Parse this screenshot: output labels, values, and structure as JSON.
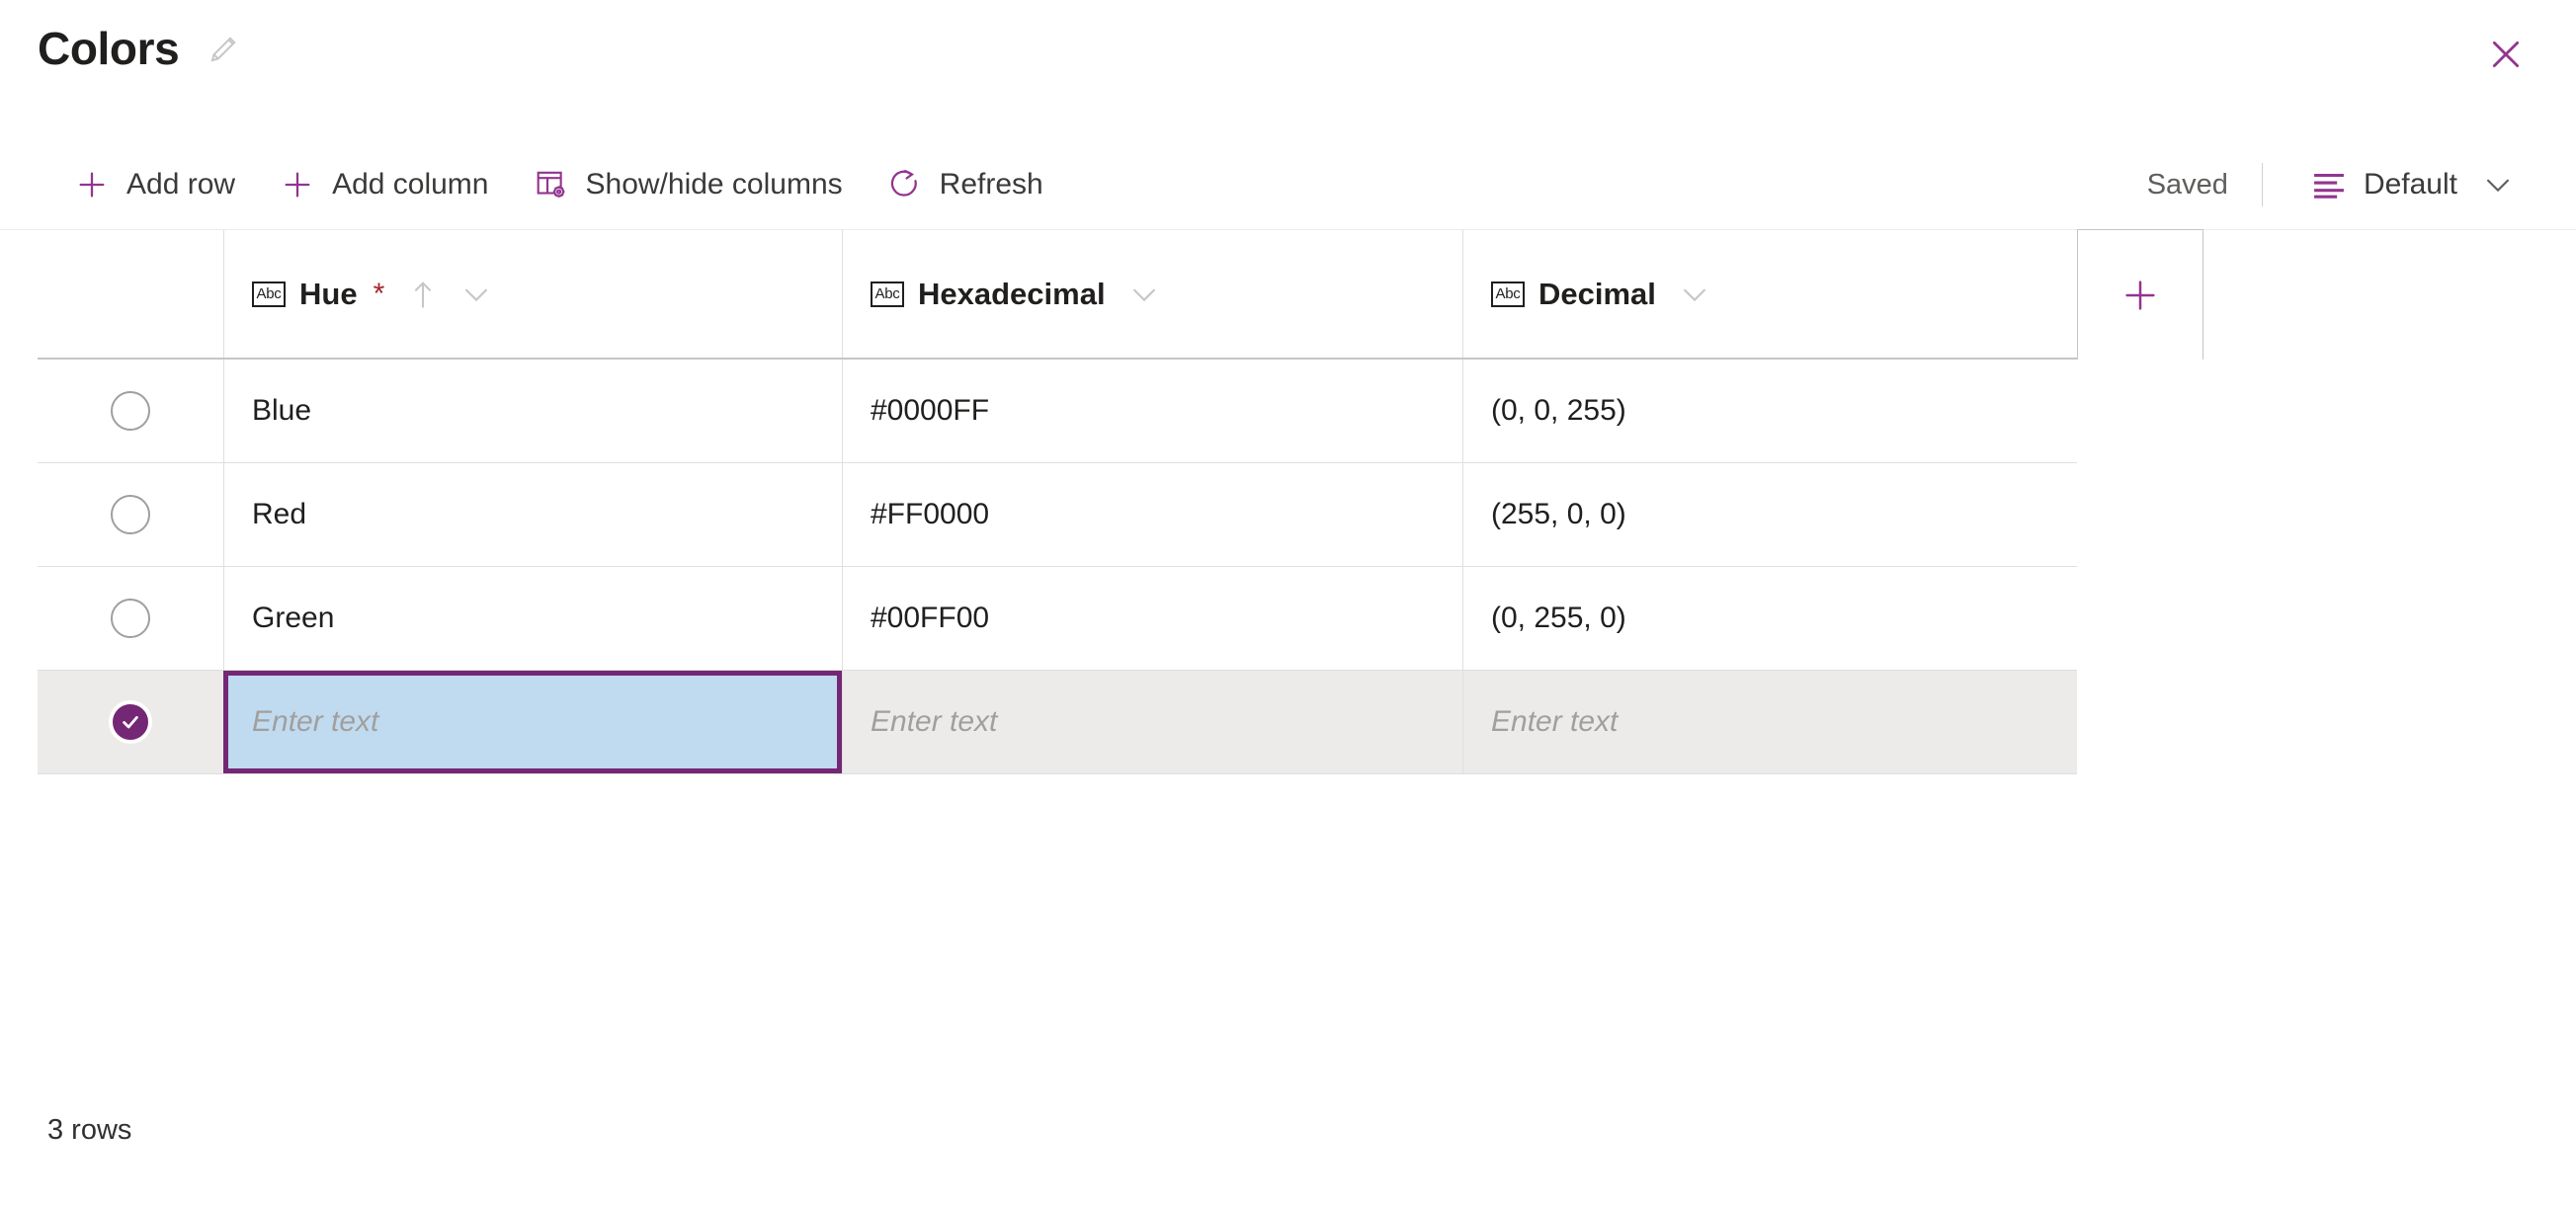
{
  "header": {
    "title": "Colors",
    "edit_icon": "pencil-icon",
    "close_icon": "close-icon"
  },
  "toolbar": {
    "commands": [
      {
        "label": "Add row",
        "icon": "plus-icon"
      },
      {
        "label": "Add column",
        "icon": "plus-icon"
      },
      {
        "label": "Show/hide columns",
        "icon": "columns-settings-icon"
      },
      {
        "label": "Refresh",
        "icon": "refresh-icon"
      }
    ],
    "status": "Saved",
    "view": {
      "label": "Default",
      "icon": "view-list-icon",
      "chevron": "chevron-down-icon"
    }
  },
  "grid": {
    "add_column_icon": "plus-icon",
    "columns": [
      {
        "label": "Hue",
        "type_icon": "Abc",
        "required": true,
        "required_marker": "*",
        "sorted": true,
        "sort_icon": "sort-ascending-icon",
        "chevron": "chevron-down-icon"
      },
      {
        "label": "Hexadecimal",
        "type_icon": "Abc",
        "required": false,
        "required_marker": "",
        "sorted": false,
        "sort_icon": "",
        "chevron": "chevron-down-icon"
      },
      {
        "label": "Decimal",
        "type_icon": "Abc",
        "required": false,
        "required_marker": "",
        "sorted": false,
        "sort_icon": "",
        "chevron": "chevron-down-icon"
      }
    ],
    "rows": [
      {
        "selected": false,
        "hue": "Blue",
        "hexadecimal": "#0000FF",
        "decimal": "(0, 0, 255)"
      },
      {
        "selected": false,
        "hue": "Red",
        "hexadecimal": "#FF0000",
        "decimal": "(255, 0, 0)"
      },
      {
        "selected": false,
        "hue": "Green",
        "hexadecimal": "#00FF00",
        "decimal": "(0, 255, 0)"
      }
    ],
    "new_row": {
      "selected": true,
      "hue_placeholder": "Enter text",
      "hexadecimal_placeholder": "Enter text",
      "decimal_placeholder": "Enter text",
      "active_column": "hue"
    }
  },
  "footer": {
    "row_count_label": "3 rows"
  },
  "colors": {
    "accent": "#742774",
    "required": "#a4262c",
    "active_cell_fill": "#c0dbf0",
    "selected_row_fill": "#edebe9",
    "text": "#201f1e",
    "muted_text": "#605e5c",
    "placeholder_text": "#a19f9d",
    "border": "#e1dfdd"
  }
}
